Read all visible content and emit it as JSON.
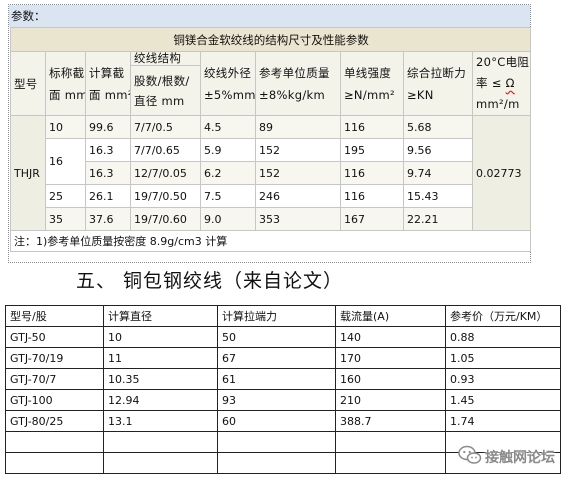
{
  "params_label": "参数：",
  "table1": {
    "title": "铜镁合金软绞线的结构尺寸及性能参数",
    "header": {
      "model": "型号",
      "nominal_area": {
        "line1": "标称截",
        "line2": "面 mm²"
      },
      "calc_area": {
        "line1": "计算截",
        "line2": "面 mm²"
      },
      "structure": {
        "title": "绞线结构",
        "line1": "股数/根数/",
        "line2": "直径 mm"
      },
      "outer_diameter": {
        "line1": "绞线外径",
        "line2": "±5%mm"
      },
      "unit_mass": {
        "line1": "参考单位质量",
        "line2": "±8%kg/km"
      },
      "wire_strength": {
        "line1": "单线强度",
        "line2": "≥N/mm²"
      },
      "breaking_force": {
        "line1": "综合拉断力",
        "line2": "≥KN"
      },
      "resistivity": {
        "line1": "20°C电阻",
        "line2_prefix": "率 ≤ ",
        "line2_symbol": "Ω",
        "line3": "mm²/m"
      }
    },
    "model": "THJR",
    "resistivity_value": "0.02773",
    "rows": [
      {
        "nominal": "10",
        "calc": "99.6",
        "structure": "7/7/0.5",
        "diameter": "4.5",
        "mass": "89",
        "strength": "116",
        "breaking": "5.68"
      },
      {
        "nominal": "16",
        "calc": "16.3",
        "structure": "7/7/0.65",
        "diameter": "5.9",
        "mass": "152",
        "strength": "195",
        "breaking": "9.56"
      },
      {
        "calc": "16.3",
        "structure": "12/7/0.05",
        "diameter": "6.2",
        "mass": "152",
        "strength": "116",
        "breaking": "9.74"
      },
      {
        "nominal": "25",
        "calc": "26.1",
        "structure": "19/7/0.50",
        "diameter": "7.5",
        "mass": "246",
        "strength": "116",
        "breaking": "15.43"
      },
      {
        "nominal": "35",
        "calc": "37.6",
        "structure": "19/7/0.60",
        "diameter": "9.0",
        "mass": "353",
        "strength": "167",
        "breaking": "22.21"
      }
    ],
    "note": "注：1)参考单位质量按密度 8.9g/cm3 计算"
  },
  "heading": "五、 铜包钢绞线（来自论文）",
  "table2": {
    "headers": [
      "型号/股",
      "计算直径",
      "计算拉端力",
      "载流量(A)",
      "参考价（万元/KM）"
    ],
    "rows": [
      [
        "GTJ-50",
        "10",
        "50",
        "140",
        "0.88"
      ],
      [
        "GTJ-70/19",
        "11",
        "67",
        "170",
        "1.05"
      ],
      [
        "GTJ-70/7",
        "10.35",
        "61",
        "160",
        "0.93"
      ],
      [
        "GTJ-100",
        "12.94",
        "93",
        "210",
        "1.45"
      ],
      [
        "GTJ-80/25",
        "13.1",
        "60",
        "388.7",
        "1.74"
      ]
    ]
  },
  "watermark": {
    "text": "接触网论坛",
    "icon": "wechat-icon"
  },
  "colors": {
    "params_bg": "#dbe5f1",
    "title_bg": "#e9e5cf",
    "header_bg": "#f4f3ea",
    "spell_check_underline": "#e02020"
  }
}
